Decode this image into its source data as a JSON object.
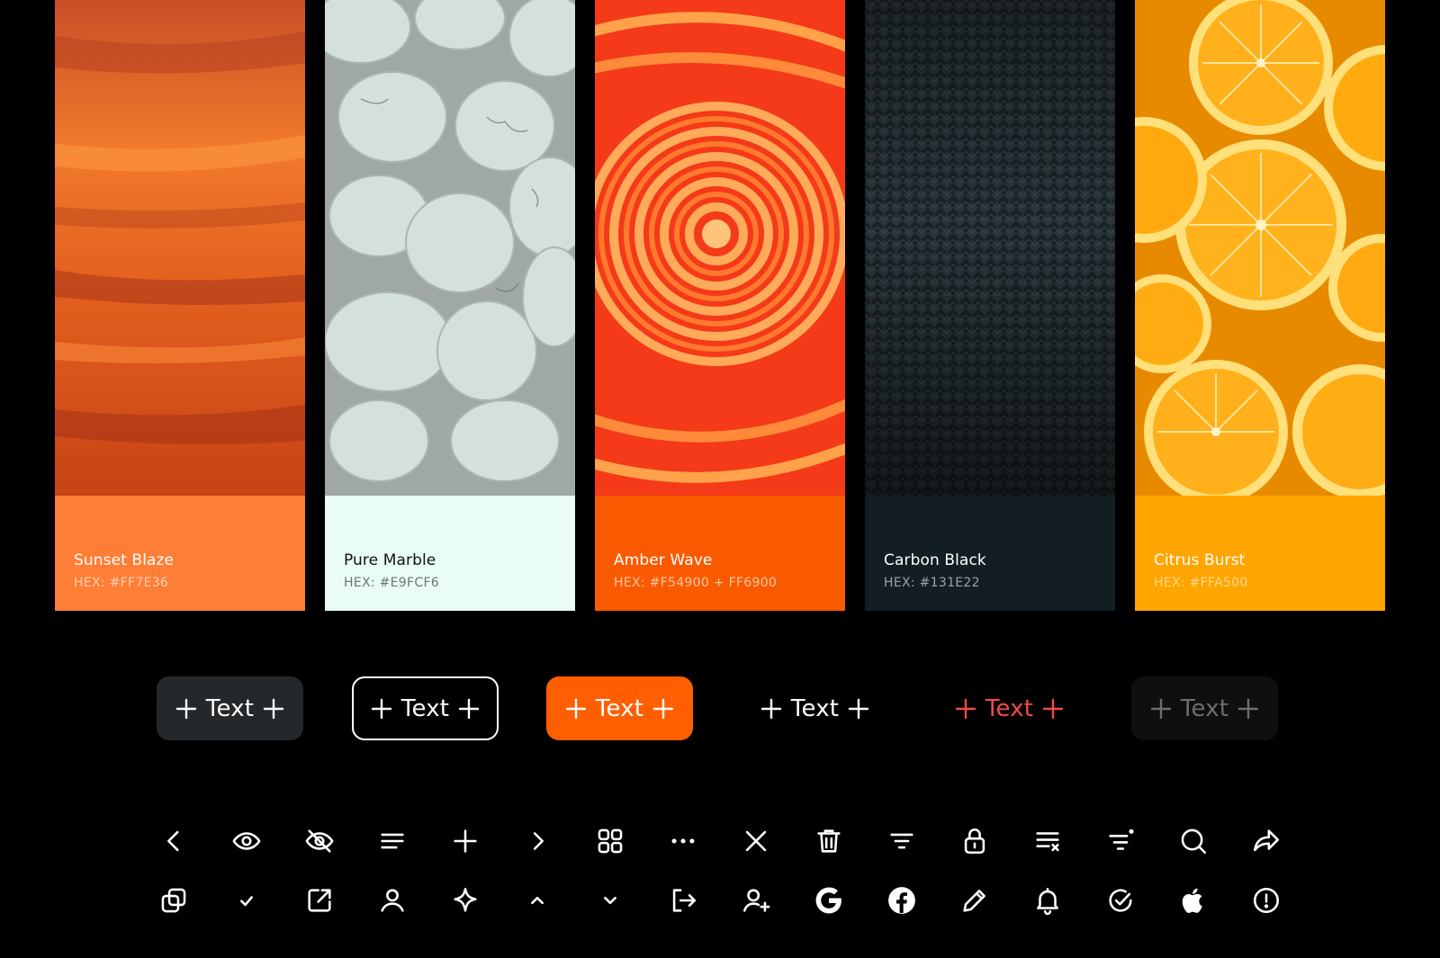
{
  "palette": [
    {
      "name": "Sunset Blaze",
      "hex": "HEX: #FF7E36",
      "color": "#FF7E36",
      "text_color": "#FFFFFF",
      "hex_text_color": "#FFD2B5"
    },
    {
      "name": "Pure Marble",
      "hex": "HEX: #E9FCF6",
      "color": "#E9FCF6",
      "text_color": "#111111",
      "hex_text_color": "#6E7673"
    },
    {
      "name": "Amber Wave",
      "hex": "HEX: #F54900 + FF6900",
      "color": "#F95A00",
      "text_color": "#FFFFFF",
      "hex_text_color": "#FFC6A0"
    },
    {
      "name": "Carbon Black",
      "hex": "HEX: #131E22",
      "color": "#131E22",
      "text_color": "#FFFFFF",
      "hex_text_color": "#9AA3A6"
    },
    {
      "name": "Citrus Burst",
      "hex": "HEX: #FFA500",
      "color": "#FFA500",
      "text_color": "#FFFFFF",
      "hex_text_color": "#FFD98E"
    }
  ],
  "buttons": [
    {
      "label": "Text",
      "variant": "dark-filled"
    },
    {
      "label": "Text",
      "variant": "outline"
    },
    {
      "label": "Text",
      "variant": "orange-filled"
    },
    {
      "label": "Text",
      "variant": "plain"
    },
    {
      "label": "Text",
      "variant": "danger-text"
    },
    {
      "label": "Text",
      "variant": "disabled"
    }
  ],
  "icons": {
    "row1": [
      "chevron-left-icon",
      "eye-icon",
      "eye-off-icon",
      "menu-lines-icon",
      "plus-icon",
      "chevron-right-icon",
      "grid-icon",
      "more-horizontal-icon",
      "close-icon",
      "trash-icon",
      "filter-icon",
      "lock-icon",
      "clear-list-icon",
      "filter-notification-icon",
      "search-icon",
      "share-icon"
    ],
    "row2": [
      "copy-icon",
      "check-icon",
      "external-link-icon",
      "user-icon",
      "sparkle-icon",
      "chevron-up-icon",
      "chevron-down-icon",
      "logout-icon",
      "add-user-icon",
      "google-icon",
      "facebook-icon",
      "pencil-icon",
      "bell-icon",
      "check-circle-icon",
      "apple-icon",
      "alert-circle-icon"
    ]
  },
  "colors": {
    "background": "#000000",
    "accent_orange": "#FF5F00",
    "danger_red": "#F04A4A",
    "dark_button": "#25282B",
    "disabled_text": "#6B6E70"
  }
}
